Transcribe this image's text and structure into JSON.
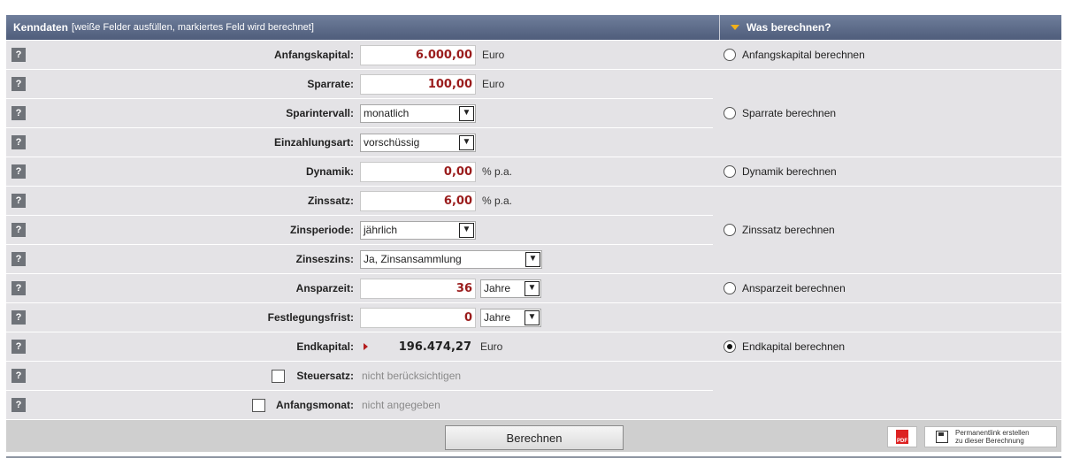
{
  "header": {
    "title": "Kenndaten",
    "subtitle": "[weiße Felder ausfüllen, markiertes Feld wird berechnet]",
    "right_title": "Was berechnen?"
  },
  "rows": [
    {
      "label": "Anfangskapital:",
      "value": "6.000,00",
      "unit": "Euro"
    },
    {
      "label": "Sparrate:",
      "value": "100,00",
      "unit": "Euro"
    },
    {
      "label": "Sparintervall:",
      "select": "monatlich"
    },
    {
      "label": "Einzahlungsart:",
      "select": "vorschüssig"
    },
    {
      "label": "Dynamik:",
      "value": "0,00",
      "unit": "% p.a."
    },
    {
      "label": "Zinssatz:",
      "value": "6,00",
      "unit": "% p.a."
    },
    {
      "label": "Zinsperiode:",
      "select": "jährlich"
    },
    {
      "label": "Zinseszins:",
      "select": "Ja, Zinsansammlung"
    },
    {
      "label": "Ansparzeit:",
      "value": "36",
      "select": "Jahre"
    },
    {
      "label": "Festlegungsfrist:",
      "value": "0",
      "select": "Jahre"
    },
    {
      "label": "Endkapital:",
      "value": "196.474,27",
      "unit": "Euro"
    },
    {
      "label": "Steuersatz:",
      "note": "nicht berücksichtigen"
    },
    {
      "label": "Anfangsmonat:",
      "note": "nicht angegeben"
    }
  ],
  "help_label": "?",
  "options": [
    {
      "label": "Anfangskapital berechnen",
      "selected": false
    },
    {
      "label": "Sparrate berechnen",
      "selected": false
    },
    {
      "label": "Dynamik berechnen",
      "selected": false
    },
    {
      "label": "Zinssatz berechnen",
      "selected": false
    },
    {
      "label": "Ansparzeit berechnen",
      "selected": false
    },
    {
      "label": "Endkapital berechnen",
      "selected": true
    }
  ],
  "footer": {
    "calculate_label": "Berechnen",
    "pdf_label": "PDF",
    "permalink_line1": "Permanentlink erstellen",
    "permalink_line2": "zu dieser Berechnung"
  }
}
